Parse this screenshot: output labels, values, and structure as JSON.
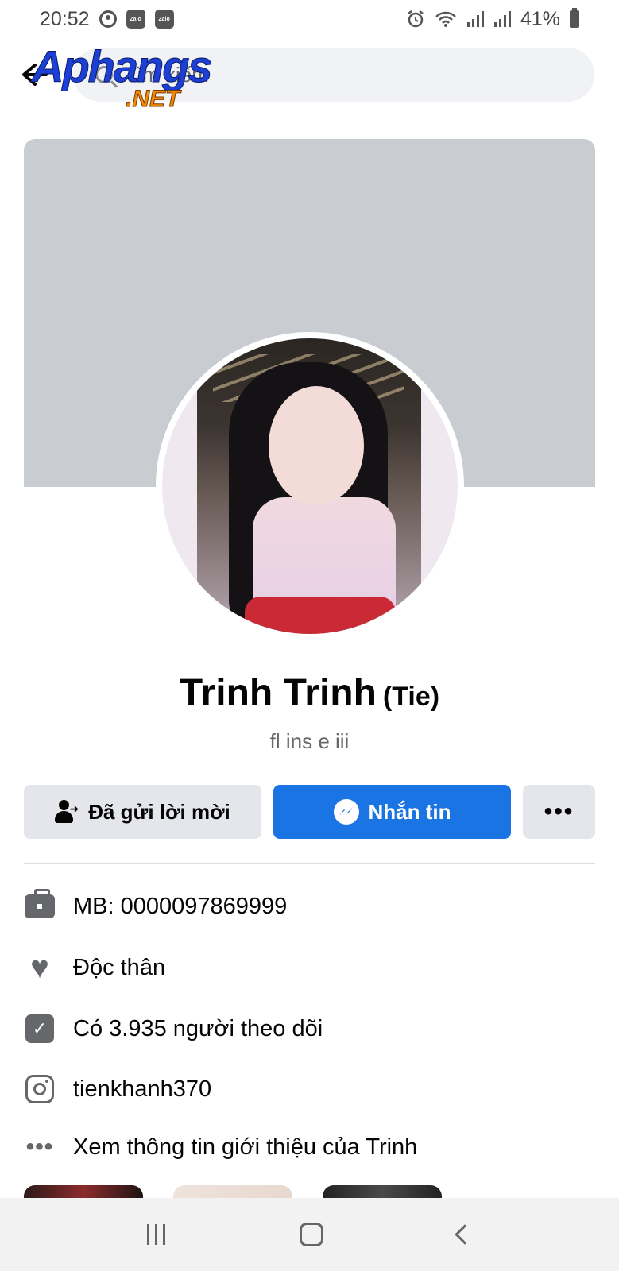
{
  "status_bar": {
    "time": "20:52",
    "notification_icons": [
      "account-circle-icon",
      "zalo-icon",
      "zalo-icon"
    ],
    "zalo_label": "Zalo",
    "right_icons": [
      "alarm-icon",
      "wifi-icon",
      "signal-icon",
      "signal-icon",
      "battery-icon"
    ],
    "battery": "41%"
  },
  "header": {
    "search_placeholder": "Tìm kiếm",
    "watermark_main": "Aphangs",
    "watermark_sub": ".NET"
  },
  "profile": {
    "name": "Trinh Trinh",
    "nickname": "(Tie)",
    "bio": "fl ins e iii"
  },
  "actions": {
    "request_label": "Đã gửi lời mời",
    "message_label": "Nhắn tin",
    "more_label": "•••"
  },
  "info": [
    {
      "icon": "briefcase-icon",
      "text": "MB: 0000097869999"
    },
    {
      "icon": "heart-icon",
      "text": "Độc thân"
    },
    {
      "icon": "followers-icon",
      "text": "Có 3.935 người theo dõi"
    },
    {
      "icon": "instagram-icon",
      "text": "tienkhanh370"
    },
    {
      "icon": "more-dots-icon",
      "text": "Xem thông tin giới thiệu của Trinh"
    }
  ],
  "colors": {
    "primary": "#1b74e4",
    "secondary_button": "#e4e6eb",
    "cover": "#c9ccd1",
    "icon_gray": "#65676b"
  }
}
